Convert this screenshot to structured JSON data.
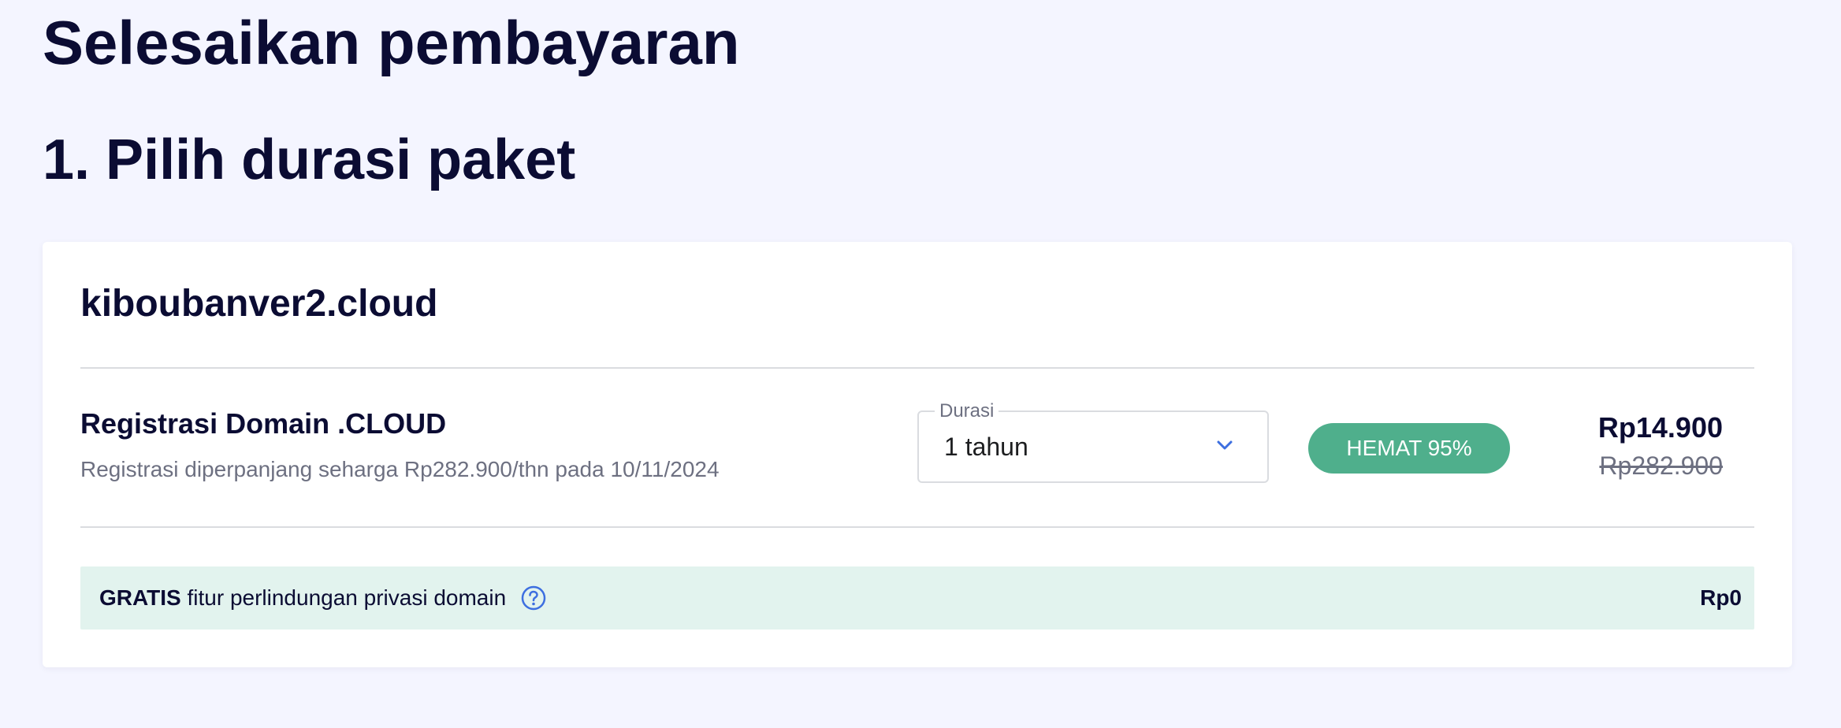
{
  "page": {
    "title": "Selesaikan pembayaran",
    "section_title": "1. Pilih durasi paket"
  },
  "card": {
    "domain": "kiboubanver2.cloud",
    "product": {
      "name": "Registrasi Domain .CLOUD",
      "renewal_note": "Registrasi diperpanjang seharga Rp282.900/thn pada 10/11/2024"
    },
    "duration": {
      "label": "Durasi",
      "selected": "1 tahun"
    },
    "badge": {
      "text": "HEMAT 95%"
    },
    "price": {
      "current": "Rp14.900",
      "original": "Rp282.900"
    },
    "privacy": {
      "free_label": "GRATIS",
      "text": " fitur perlindungan privasi domain",
      "price": "Rp0"
    }
  },
  "icons": {
    "duration_chevron": "chevron-down-icon",
    "privacy_help": "help-circle-icon"
  },
  "colors": {
    "background": "#f4f5ff",
    "heading": "#0b0c33",
    "accent_blue": "#3d6fe0",
    "badge_green": "#4faf8c",
    "privacy_row_bg": "#e2f3ee",
    "muted_text": "#6d7081"
  }
}
